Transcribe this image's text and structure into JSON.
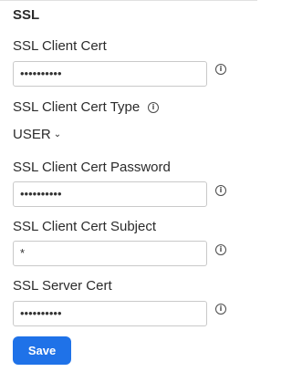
{
  "section": {
    "title": "SSL"
  },
  "fields": {
    "client_cert": {
      "label": "SSL Client Cert",
      "value": "••••••••••",
      "info_icon": "info-icon"
    },
    "client_cert_type": {
      "label": "SSL Client Cert Type",
      "value": "USER",
      "info_icon": "info-icon",
      "dropdown_icon": "chevron-down-icon"
    },
    "client_cert_password": {
      "label": "SSL Client Cert Password",
      "value": "••••••••••",
      "info_icon": "info-icon"
    },
    "client_cert_subject": {
      "label": "SSL Client Cert Subject",
      "value": "*",
      "info_icon": "info-icon"
    },
    "server_cert": {
      "label": "SSL Server Cert",
      "value": "••••••••••",
      "info_icon": "info-icon"
    }
  },
  "actions": {
    "save_label": "Save"
  },
  "colors": {
    "primary_button": "#1f72e8",
    "text": "#2b2b2b",
    "field_border": "#c9c9c9"
  }
}
